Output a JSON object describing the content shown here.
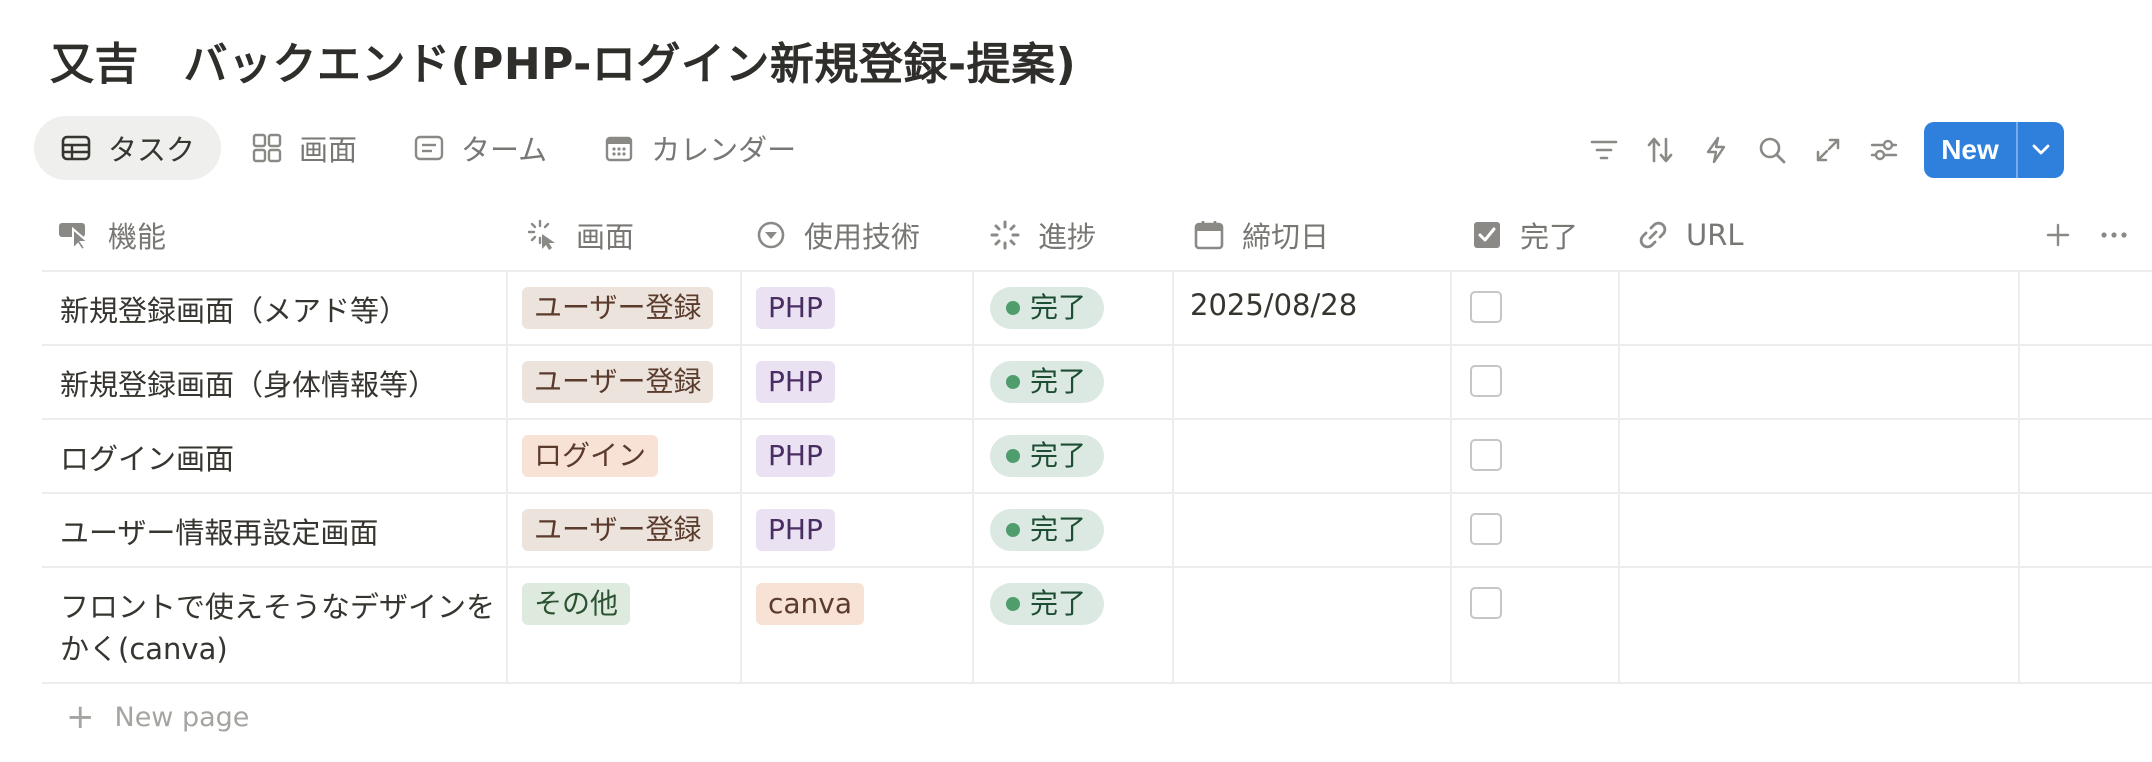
{
  "page": {
    "title": "又吉　バックエンド(PHP-ログイン新規登録-提案)"
  },
  "views": [
    {
      "label": "タスク",
      "icon": "table-icon",
      "active": true
    },
    {
      "label": "画面",
      "icon": "gallery-icon",
      "active": false
    },
    {
      "label": "ターム",
      "icon": "list-icon",
      "active": false
    },
    {
      "label": "カレンダー",
      "icon": "calendar-icon",
      "active": false
    }
  ],
  "toolbar": {
    "icons": [
      "filter-icon",
      "sort-icon",
      "automation-icon",
      "search-icon",
      "expand-icon",
      "settings-icon"
    ],
    "new_label": "New",
    "accent": "#2f7fdd"
  },
  "columns": [
    {
      "label": "機能",
      "icon": "cursor-icon"
    },
    {
      "label": "画面",
      "icon": "select-icon"
    },
    {
      "label": "使用技術",
      "icon": "multiselect-icon"
    },
    {
      "label": "進捗",
      "icon": "status-icon"
    },
    {
      "label": "締切日",
      "icon": "date-icon"
    },
    {
      "label": "完了",
      "icon": "checkbox-icon"
    },
    {
      "label": "URL",
      "icon": "link-icon"
    }
  ],
  "rows": [
    {
      "feature": "新規登録画面（メアド等）",
      "screen": "ユーザー登録",
      "tech": "PHP",
      "status": "完了",
      "deadline": "2025/08/28",
      "done": false
    },
    {
      "feature": "新規登録画面（身体情報等）",
      "screen": "ユーザー登録",
      "tech": "PHP",
      "status": "完了",
      "deadline": "",
      "done": false
    },
    {
      "feature": "ログイン画面",
      "screen": "ログイン",
      "tech": "PHP",
      "status": "完了",
      "deadline": "",
      "done": false
    },
    {
      "feature": "ユーザー情報再設定画面",
      "screen": "ユーザー登録",
      "tech": "PHP",
      "status": "完了",
      "deadline": "",
      "done": false
    },
    {
      "feature_line1": "フロントで使えそうなデザインを",
      "feature_line2": "かく(canva)",
      "screen": "その他",
      "tech": "canva",
      "status": "完了",
      "deadline": "",
      "done": false
    }
  ],
  "tag_colors": {
    "ユーザー登録": "#ece3dd",
    "ログイン": "#f7e2d5",
    "その他": "#dfeadf",
    "PHP": "#eae1f2",
    "canva": "#f7e2d5",
    "status_green": "#dbe9e2"
  },
  "footer": {
    "new_page_label": "New page"
  }
}
